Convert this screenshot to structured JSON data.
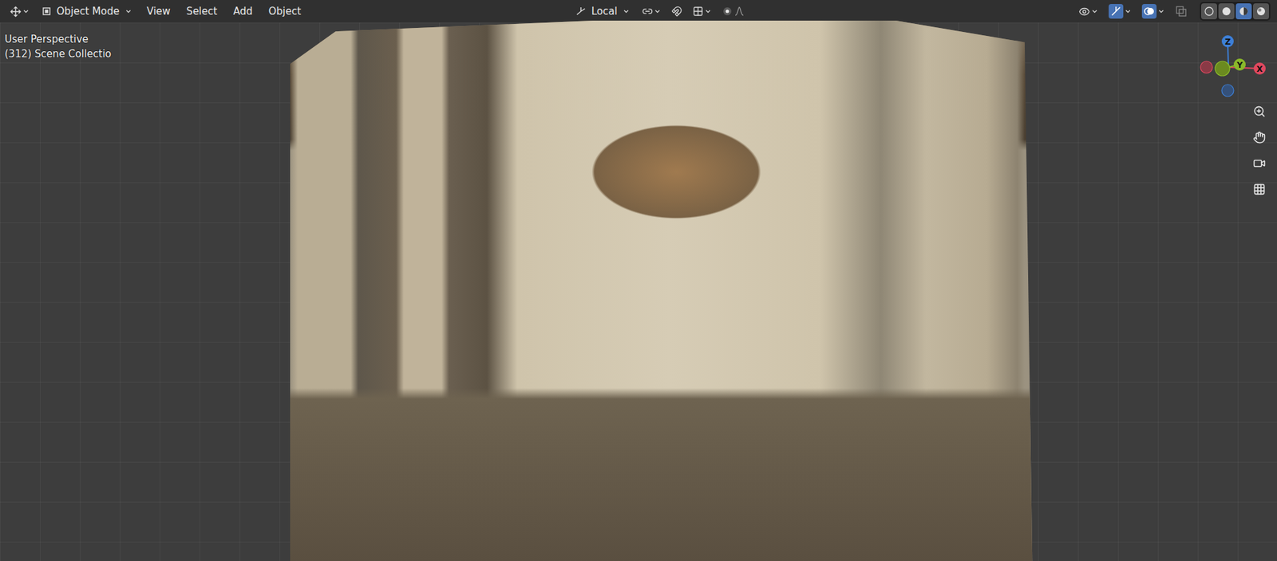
{
  "header": {
    "mode": "Object Mode",
    "menus": [
      "View",
      "Select",
      "Add",
      "Object"
    ],
    "orientation": "Local"
  },
  "viewport": {
    "view_name": "User Perspective",
    "collection": "(312) Scene Collectio"
  },
  "gizmo": {
    "axes": [
      {
        "label": "Z",
        "color": "#3d7fd6"
      },
      {
        "label": "Y",
        "color": "#8ab82a"
      },
      {
        "label": "X",
        "color": "#e0485f"
      }
    ]
  },
  "shading": [
    {
      "kind": "wireframe",
      "selected": false
    },
    {
      "kind": "solid",
      "selected": false
    },
    {
      "kind": "material",
      "selected": true
    },
    {
      "kind": "rendered",
      "selected": false
    }
  ]
}
